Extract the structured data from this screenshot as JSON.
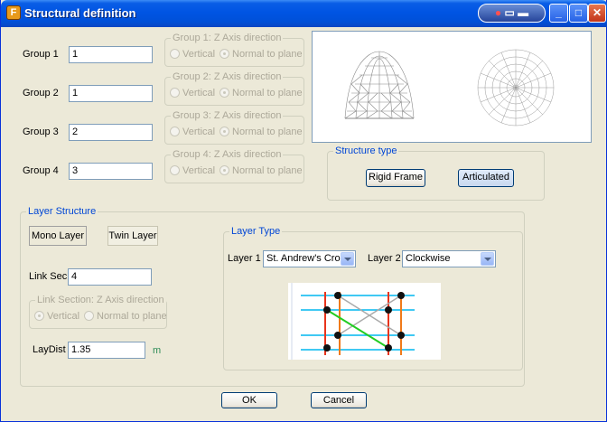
{
  "window": {
    "title": "Structural definition",
    "icon": "app-logo-icon"
  },
  "groups": [
    {
      "label": "Group 1",
      "value": "1",
      "axis_title": "Group 1: Z Axis direction",
      "opt_vertical": "Vertical",
      "opt_normal": "Normal to plane"
    },
    {
      "label": "Group 2",
      "value": "1",
      "axis_title": "Group 2: Z Axis direction",
      "opt_vertical": "Vertical",
      "opt_normal": "Normal to plane"
    },
    {
      "label": "Group 3",
      "value": "2",
      "axis_title": "Group 3: Z Axis direction",
      "opt_vertical": "Vertical",
      "opt_normal": "Normal to plane"
    },
    {
      "label": "Group 4",
      "value": "3",
      "axis_title": "Group 4: Z Axis direction",
      "opt_vertical": "Vertical",
      "opt_normal": "Normal to plane"
    }
  ],
  "structure_type": {
    "title": "Structure type",
    "rigid_frame": "Rigid Frame",
    "articulated": "Articulated"
  },
  "layer_structure": {
    "title": "Layer Structure",
    "mono_layer": "Mono Layer",
    "twin_layer": "Twin Layer",
    "link_sec_label": "Link Sec",
    "link_sec_value": "4",
    "link_axis_title": "Link Section: Z Axis direction",
    "opt_vertical": "Vertical",
    "opt_normal": "Normal to plane",
    "laydist_label": "LayDist",
    "laydist_value": "1.35",
    "laydist_unit": "m"
  },
  "layer_type": {
    "title": "Layer Type",
    "layer1_label": "Layer 1",
    "layer1_value": "St. Andrew's Cross",
    "layer2_label": "Layer 2",
    "layer2_value": "Clockwise"
  },
  "buttons": {
    "ok": "OK",
    "cancel": "Cancel"
  },
  "colors": {
    "titlebar": "#0054e3",
    "groupbox_title": "#0046d5",
    "unit": "#2e8b57"
  }
}
